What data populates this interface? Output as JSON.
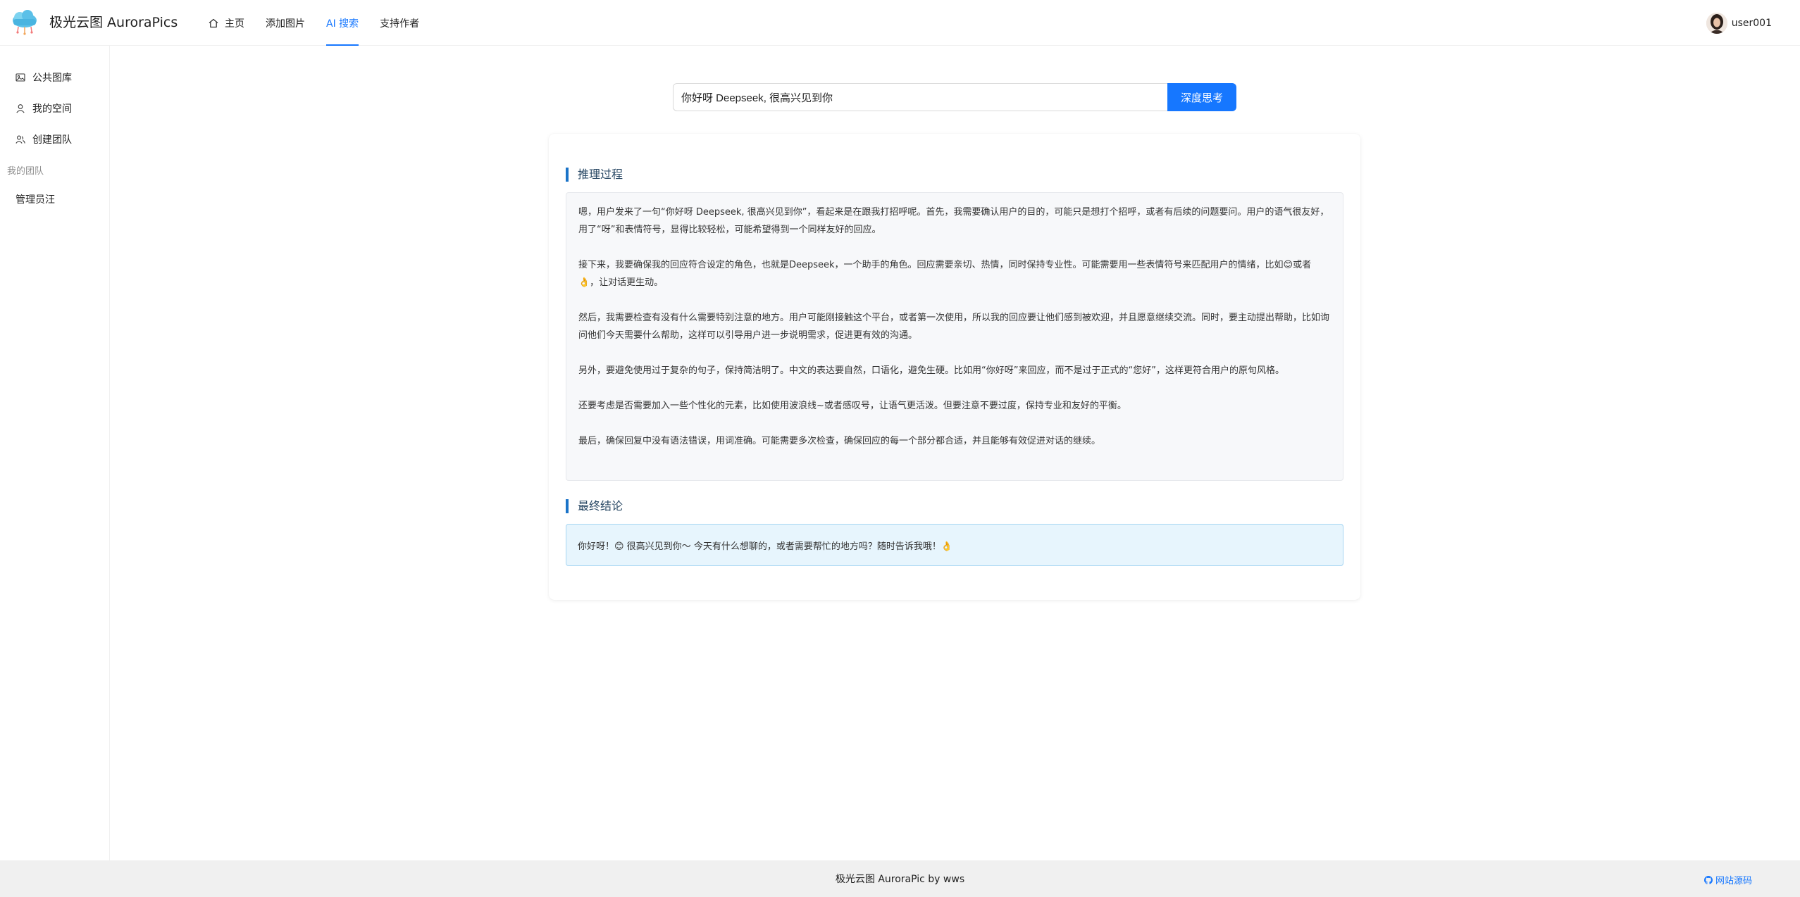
{
  "app": {
    "title": "极光云图 AuroraPics"
  },
  "nav": {
    "items": [
      {
        "label": "主页",
        "icon": "home-icon"
      },
      {
        "label": "添加图片"
      },
      {
        "label": "AI 搜索",
        "active": true
      },
      {
        "label": "支持作者"
      }
    ]
  },
  "user": {
    "name": "user001"
  },
  "sidebar": {
    "items": [
      {
        "label": "公共图库",
        "icon": "picture-icon"
      },
      {
        "label": "我的空间",
        "icon": "user-icon"
      },
      {
        "label": "创建团队",
        "icon": "team-icon"
      }
    ],
    "group_title": "我的团队",
    "team_items": [
      {
        "label": "管理员汪"
      }
    ]
  },
  "search": {
    "value": "你好呀 Deepseek, 很高兴见到你",
    "button_label": "深度思考"
  },
  "result": {
    "reasoning_title": "推理过程",
    "reasoning_paragraphs": [
      "嗯，用户发来了一句“你好呀 Deepseek, 很高兴见到你”，看起来是在跟我打招呼呢。首先，我需要确认用户的目的，可能只是想打个招呼，或者有后续的问题要问。用户的语气很友好，用了“呀”和表情符号，显得比较轻松，可能希望得到一个同样友好的回应。",
      "接下来，我要确保我的回应符合设定的角色，也就是Deepseek，一个助手的角色。回应需要亲切、热情，同时保持专业性。可能需要用一些表情符号来匹配用户的情绪，比如😊或者👌，让对话更生动。",
      "然后，我需要检查有没有什么需要特别注意的地方。用户可能刚接触这个平台，或者第一次使用，所以我的回应要让他们感到被欢迎，并且愿意继续交流。同时，要主动提出帮助，比如询问他们今天需要什么帮助，这样可以引导用户进一步说明需求，促进更有效的沟通。",
      "另外，要避免使用过于复杂的句子，保持简洁明了。中文的表达要自然，口语化，避免生硬。比如用“你好呀”来回应，而不是过于正式的“您好”，这样更符合用户的原句风格。",
      "还要考虑是否需要加入一些个性化的元素，比如使用波浪线~或者感叹号，让语气更活泼。但要注意不要过度，保持专业和友好的平衡。",
      "最后，确保回复中没有语法错误，用词准确。可能需要多次检查，确保回应的每一个部分都合适，并且能够有效促进对话的继续。"
    ],
    "conclusion_title": "最终结论",
    "conclusion_text": "你好呀！😊 很高兴见到你～ 今天有什么想聊的，或者需要帮忙的地方吗？随时告诉我哦！👌"
  },
  "footer": {
    "text": "极光云图 AuroraPic by wws",
    "link_label": "网站源码",
    "link_icon": "github-icon"
  },
  "colors": {
    "primary": "#1677ff",
    "accent_bar": "#1a73c8",
    "conclusion_bg": "#e7f5fd"
  }
}
